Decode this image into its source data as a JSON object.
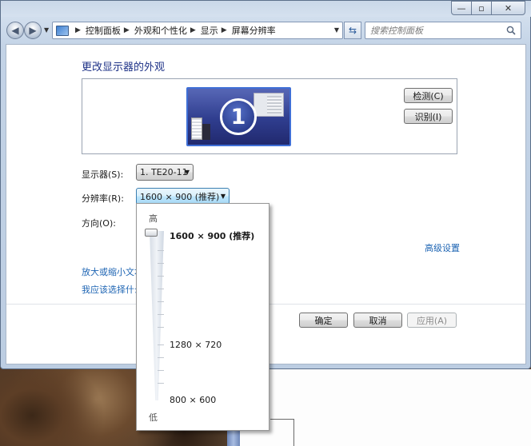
{
  "nav": {
    "breadcrumb": [
      "控制面板",
      "外观和个性化",
      "显示",
      "屏幕分辨率"
    ],
    "search_placeholder": "搜索控制面板"
  },
  "page": {
    "title": "更改显示器的外观",
    "monitor_number": "1",
    "detect_button": "检测(C)",
    "identify_button": "识别(I)",
    "display_label": "显示器(S):",
    "display_value": "1. TE20-11",
    "resolution_label": "分辨率(R):",
    "resolution_value": "1600 × 900 (推荐)",
    "orientation_label": "方向(O):",
    "advanced_link": "高级设置",
    "zoom_link": "放大或缩小文本",
    "choose_link": "我应该选择什么",
    "ok_button": "确定",
    "cancel_button": "取消",
    "apply_button": "应用(A)"
  },
  "resolution_popup": {
    "high_label": "高",
    "low_label": "低",
    "options": [
      "1600 × 900 (推荐)",
      "1280 × 720",
      "800 × 600"
    ],
    "selected": "1600 × 900 (推荐)"
  },
  "colors": {
    "title_blue": "#1e3287",
    "link_blue": "#1d64b3",
    "monitor_blue": "#3f6fd6"
  }
}
